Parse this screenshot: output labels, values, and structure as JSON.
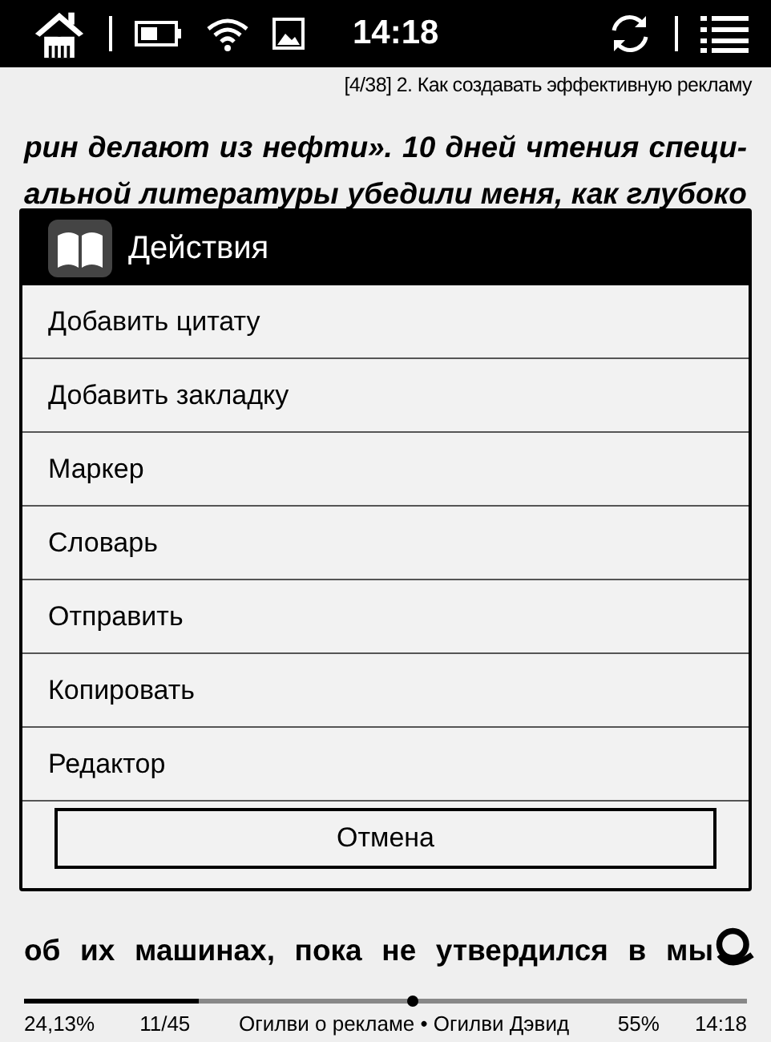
{
  "status_bar": {
    "time": "14:18"
  },
  "chapter_header": "[4/38] 2. Как создавать эффективную рекламу",
  "text_lines_top": [
    "рин делают из нефти». 10 дней чтения специ-",
    "альной литературы убедили меня, как глубоко"
  ],
  "text_lines_bottom": [
    "об их машинах, пока не утвердился в мы"
  ],
  "dialog": {
    "title": "Действия",
    "items": [
      "Добавить цитату",
      "Добавить закладку",
      "Маркер",
      "Словарь",
      "Отправить",
      "Копировать",
      "Редактор"
    ],
    "cancel": "Отмена"
  },
  "footer": {
    "percent": "24,13%",
    "page": "11/45",
    "book": "Огилви о рекламе • Огилви Дэвид",
    "level": 0.2413,
    "battery": "55%",
    "time": "14:18"
  }
}
